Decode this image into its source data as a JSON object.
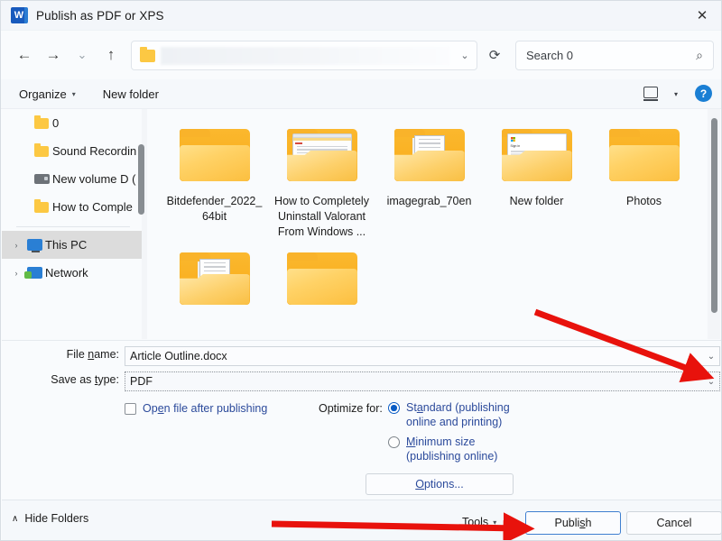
{
  "window": {
    "title": "Publish as PDF or XPS",
    "app_icon": "word-icon",
    "close_label": "✕"
  },
  "nav": {
    "back_icon": "←",
    "forward_icon": "→",
    "recent_icon": "⌄",
    "up_icon": "↑",
    "address_chevron": "⌄",
    "refresh_icon": "⟳",
    "search_value": "Search 0",
    "search_icon": "⌕"
  },
  "commandbar": {
    "organize": "Organize",
    "organize_caret": "▾",
    "new_folder": "New folder",
    "view_caret": "▾",
    "help": "?"
  },
  "sidebar": {
    "items": [
      {
        "label": "0",
        "icon": "folder-icon",
        "expander": "",
        "selected": false,
        "indent": true
      },
      {
        "label": "Sound Recordin",
        "icon": "folder-icon",
        "expander": "",
        "selected": false,
        "indent": true
      },
      {
        "label": "New volume D (",
        "icon": "drive-icon",
        "expander": "",
        "selected": false,
        "indent": true
      },
      {
        "label": "How to Comple",
        "icon": "folder-icon",
        "expander": "",
        "selected": false,
        "indent": true
      },
      {
        "label": "This PC",
        "icon": "this-pc-icon",
        "expander": "›",
        "selected": true,
        "indent": false
      },
      {
        "label": "Network",
        "icon": "network-icon",
        "expander": "›",
        "selected": false,
        "indent": false
      }
    ]
  },
  "files": [
    {
      "name": "Bitdefender_2022_64bit",
      "kind": "folder",
      "preview": "none"
    },
    {
      "name": "How to Completely Uninstall Valorant From Windows ...",
      "kind": "folder",
      "preview": "window"
    },
    {
      "name": "imagegrab_70en",
      "kind": "folder",
      "preview": "document"
    },
    {
      "name": "New folder",
      "kind": "folder",
      "preview": "signin"
    },
    {
      "name": "Photos",
      "kind": "folder",
      "preview": "none"
    },
    {
      "name": "",
      "kind": "folder",
      "preview": "document"
    },
    {
      "name": "",
      "kind": "folder",
      "preview": "none"
    }
  ],
  "form": {
    "file_name_label": "File name:",
    "file_name_label_pre": "File ",
    "file_name_label_accel": "n",
    "file_name_label_post": "ame:",
    "file_name_value": "Article Outline.docx",
    "save_type_label_pre": "Save as ",
    "save_type_label_accel": "t",
    "save_type_label_post": "ype:",
    "save_type_value": "PDF",
    "combo_chevron": "⌄",
    "open_after_pre": "Op",
    "open_after_accel": "e",
    "open_after_post": "n file after publishing",
    "open_after_checked": false,
    "optimize_label": "Optimize for:",
    "radio_standard_pre": "St",
    "radio_standard_accel": "a",
    "radio_standard_post": "ndard (publishing",
    "radio_standard_line2": "online and printing)",
    "radio_standard_selected": true,
    "radio_minimum_accel": "M",
    "radio_minimum_post": "inimum size",
    "radio_minimum_line2": "(publishing online)",
    "radio_minimum_selected": false,
    "options_pre": "",
    "options_accel": "O",
    "options_post": "ptions..."
  },
  "actions": {
    "hide_folders_caret": "∧",
    "hide_folders": "Hide Folders",
    "tools_pre": "T",
    "tools_accel": "o",
    "tools_post": "ols",
    "tools_caret": "▾",
    "publish_pre": "Publi",
    "publish_accel": "s",
    "publish_post": "h",
    "cancel": "Cancel"
  },
  "annotations": {
    "arrow_color": "#e8120c",
    "arrow_1_target": "save-as-type-dropdown-chevron",
    "arrow_2_target": "publish-button"
  }
}
